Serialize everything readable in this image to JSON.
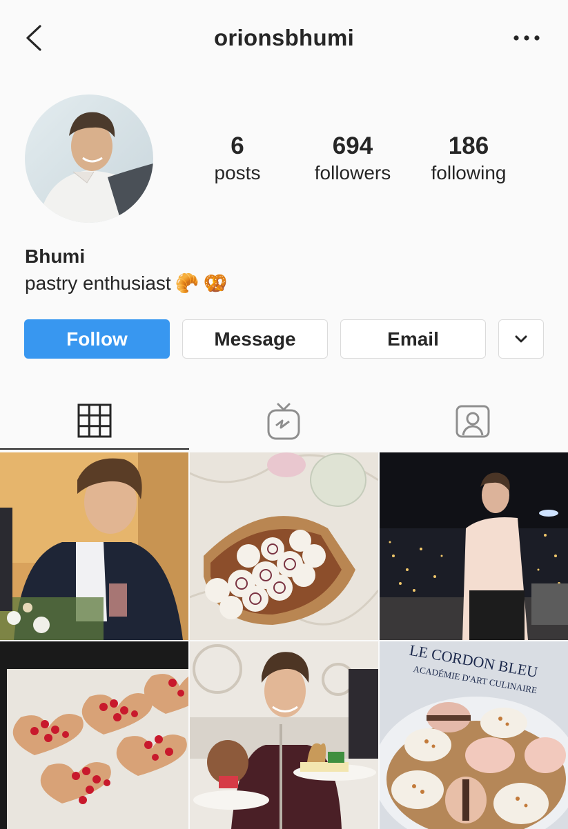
{
  "header": {
    "username": "orionsbhumi",
    "back_icon": "chevron-left-icon",
    "more_icon": "more-horizontal-icon"
  },
  "profile": {
    "name": "Bhumi",
    "bio": "pastry enthusiast",
    "bio_emojis": [
      "🥐",
      "🥨"
    ],
    "stats": [
      {
        "value": "6",
        "label": "posts"
      },
      {
        "value": "694",
        "label": "followers"
      },
      {
        "value": "186",
        "label": "following"
      }
    ]
  },
  "actions": {
    "follow": "Follow",
    "message": "Message",
    "email": "Email",
    "dropdown_icon": "chevron-down-icon"
  },
  "tabs": [
    {
      "icon": "grid-icon",
      "active": true
    },
    {
      "icon": "igtv-icon",
      "active": false
    },
    {
      "icon": "tagged-icon",
      "active": false
    }
  ],
  "posts": [
    {
      "subject": "man in navy blazer at dining table"
    },
    {
      "subject": "cinnamon rolls with icing"
    },
    {
      "subject": "man standing on terrace over night city"
    },
    {
      "subject": "strawberry heart tarts on baking tray"
    },
    {
      "subject": "man at afternoon tea with pastry stand"
    },
    {
      "subject": "macarons at Le Cordon Bleu"
    }
  ],
  "post_text": {
    "le_cordon_bleu": "LE CORDON BLEU",
    "academie": "ACADÉMIE D'ART CULINAIRE"
  },
  "colors": {
    "accent": "#3897f0",
    "text": "#262626",
    "border": "#dbdbdb",
    "background": "#fafafa"
  }
}
